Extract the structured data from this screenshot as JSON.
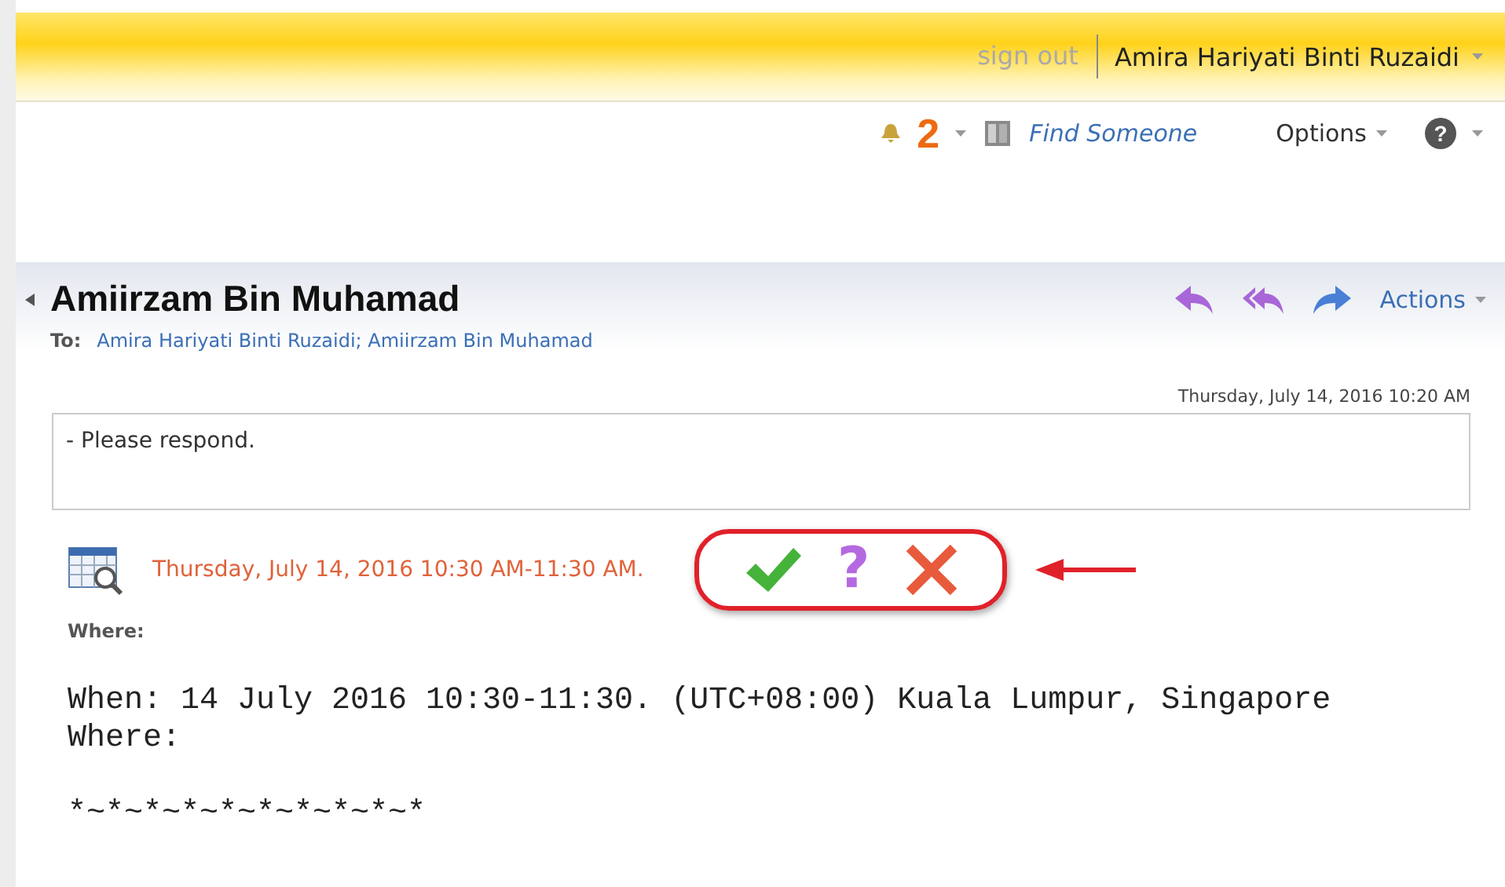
{
  "header": {
    "sign_out": "sign out",
    "user_name": "Amira Hariyati Binti Ruzaidi"
  },
  "toolbar": {
    "reminder_count": "2",
    "find_someone": "Find Someone",
    "options": "Options",
    "help": "?"
  },
  "message": {
    "sender": "Amiirzam Bin Muhamad",
    "to_label": "To:",
    "recipients": "Amira Hariyati Binti Ruzaidi; Amiirzam Bin Muhamad",
    "actions": "Actions",
    "sent": "Thursday, July 14, 2016 10:20 AM",
    "note": "- Please respond.",
    "meeting_time": "Thursday, July 14, 2016 10:30 AM-11:30 AM.",
    "where_label": "Where:",
    "responses": [
      {
        "kind": "accept"
      },
      {
        "kind": "tentative",
        "label": "?"
      },
      {
        "kind": "decline"
      }
    ],
    "body": [
      "When: 14 July 2016 10:30-11:30. (UTC+08:00) Kuala Lumpur, Singapore",
      "Where:"
    ],
    "signature": "*~*~*~*~*~*~*~*~*~*"
  }
}
